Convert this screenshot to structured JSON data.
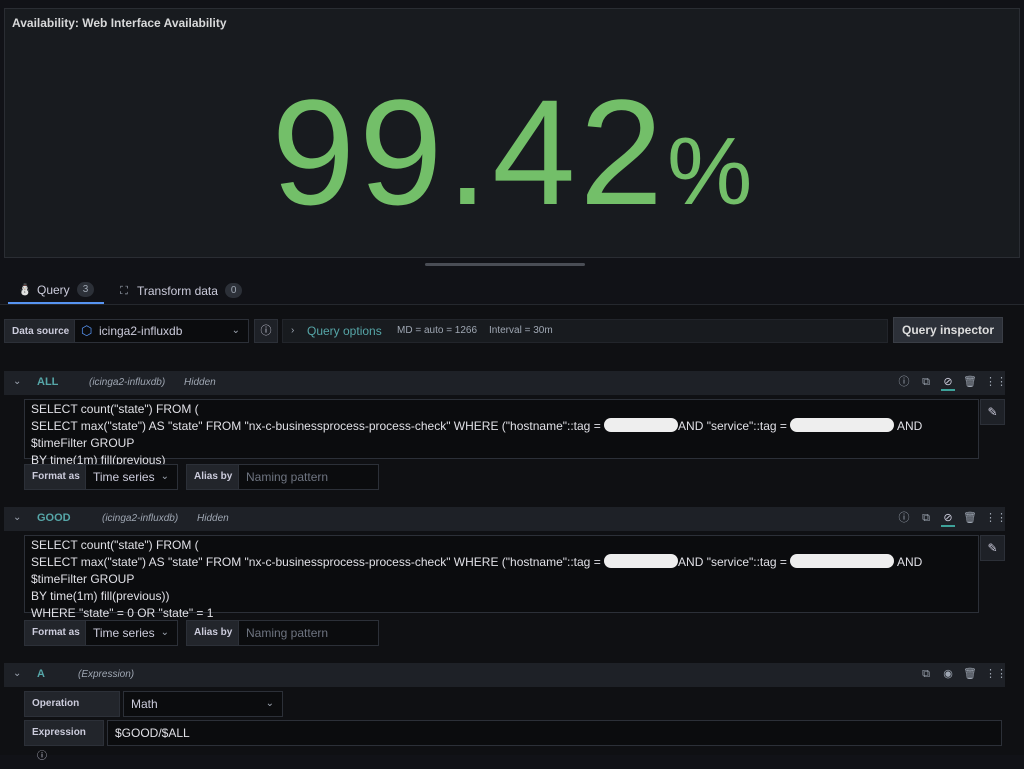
{
  "panel": {
    "title": "Availability: Web Interface Availability",
    "value": "99.42",
    "unit": "%",
    "value_color": "#73bf69"
  },
  "tabs": [
    {
      "label": "Query",
      "count": "3",
      "icon": "database-icon"
    },
    {
      "label": "Transform data",
      "count": "0",
      "icon": "transform-icon"
    }
  ],
  "datasource": {
    "label": "Data source",
    "selected": "icinga2-influxdb",
    "query_options": "Query options",
    "md": "MD = auto = 1266",
    "interval": "Interval = 30m",
    "inspector": "Query inspector"
  },
  "queries": [
    {
      "name": "ALL",
      "datasource": "(icinga2-influxdb)",
      "status": "Hidden",
      "lines": [
        "SELECT count(\"state\") FROM (",
        "SELECT max(\"state\") AS \"state\" FROM \"nx-c-businessprocess-process-check\" WHERE (\"hostname\"::tag =",
        "AND \"service\"::tag =",
        "AND $timeFilter GROUP",
        "BY time(1m) fill(previous)"
      ],
      "format_label": "Format as",
      "format_value": "Time series",
      "alias_label": "Alias by",
      "alias_placeholder": "Naming pattern"
    },
    {
      "name": "GOOD",
      "datasource": "(icinga2-influxdb)",
      "status": "Hidden",
      "lines": [
        "SELECT count(\"state\") FROM (",
        "SELECT max(\"state\") AS \"state\" FROM \"nx-c-businessprocess-process-check\" WHERE (\"hostname\"::tag =",
        "AND \"service\"::tag =",
        "AND $timeFilter GROUP",
        "BY time(1m) fill(previous))",
        "WHERE \"state\" = 0 OR \"state\" = 1"
      ],
      "format_label": "Format as",
      "format_value": "Time series",
      "alias_label": "Alias by",
      "alias_placeholder": "Naming pattern"
    },
    {
      "name": "A",
      "type": "(Expression)",
      "operation_label": "Operation",
      "operation_value": "Math",
      "expression_label": "Expression",
      "expression_value": "$GOOD/$ALL"
    }
  ],
  "colors": {
    "accent": "#56a6a8",
    "tab_active": "#5794f2",
    "background": "#111217"
  }
}
